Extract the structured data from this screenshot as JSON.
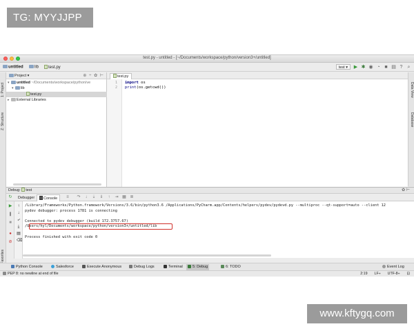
{
  "watermark_top": "TG: MYYJJPP",
  "watermark_bottom": "www.kftygq.com",
  "window": {
    "title": "test.py - untitled - [~/Documents/workspace/python/version3+/untitled]"
  },
  "navbar": {
    "crumbs": [
      "untitled",
      "lib",
      "test.py"
    ],
    "run_config": "test"
  },
  "left_strip": {
    "tabs": [
      "1: Project",
      "Z: Structure",
      "2: Favorites"
    ]
  },
  "right_strip": {
    "tabs": [
      "Data View",
      "Database"
    ]
  },
  "project": {
    "header": "Project",
    "tree": [
      {
        "label": "untitled",
        "detail": "~/Documents/workspace/python/ve"
      },
      {
        "label": "lib"
      },
      {
        "label": "test.py"
      },
      {
        "label": "External Libraries"
      }
    ]
  },
  "editor": {
    "tab": "test.py",
    "lines": [
      {
        "num": "1",
        "kw": "import",
        "rest": " os"
      },
      {
        "num": "2",
        "fn": "print",
        "rest": "(os.getcwd())"
      }
    ]
  },
  "debug": {
    "header": "Debug",
    "config": "test",
    "tabs": [
      "Debugger",
      "Console"
    ],
    "console_lines": [
      "/Library/Frameworks/Python.framework/Versions/3.6/bin/python3.6 /Applications/PyCharm.app/Contents/helpers/pydev/pydevd.py --multiproc --qt-support=auto --client 12",
      "pydev debugger: process 1781 is connecting",
      "",
      "Connected to pydev debugger (build 172.3757.67)",
      "/Users/hyl/Documents/workspace/python/version3+/untitled/lib",
      "",
      "Process finished with exit code 0"
    ]
  },
  "bottom_tabs": [
    "Python Console",
    "Salesforce",
    "Execute Anonymous",
    "Debug Logs",
    "Terminal",
    "5: Debug",
    "6: TODO"
  ],
  "event_log": "Event Log",
  "status": {
    "message": "PEP 8: no newline at end of file",
    "position": "2:19",
    "line_sep": "LF÷",
    "encoding": "UTF-8÷"
  }
}
